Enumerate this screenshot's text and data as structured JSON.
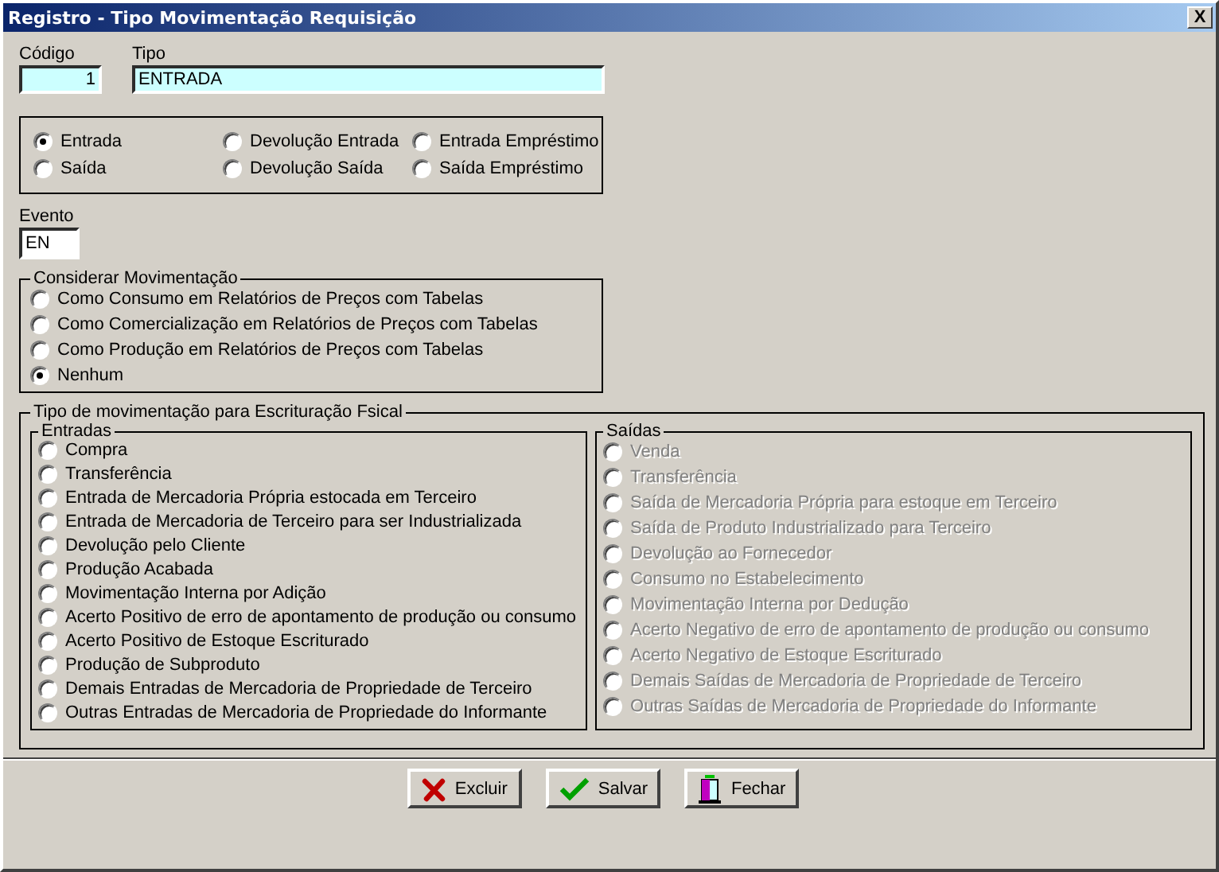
{
  "window": {
    "title": "Registro - Tipo Movimentação Requisição",
    "close": "X"
  },
  "codigo": {
    "label": "Código",
    "value": "1"
  },
  "tipo": {
    "label": "Tipo",
    "value": "ENTRADA"
  },
  "tipo_options": [
    {
      "label": "Entrada",
      "selected": true
    },
    {
      "label": "Devolução Entrada",
      "selected": false
    },
    {
      "label": "Entrada Empréstimo",
      "selected": false
    },
    {
      "label": "Saída",
      "selected": false
    },
    {
      "label": "Devolução Saída",
      "selected": false
    },
    {
      "label": "Saída Empréstimo",
      "selected": false
    }
  ],
  "evento": {
    "label": "Evento",
    "value": "EN"
  },
  "considerar": {
    "title": "Considerar Movimentação",
    "options": [
      {
        "label": "Como Consumo em Relatórios de Preços com Tabelas",
        "selected": false
      },
      {
        "label": "Como Comercialização em Relatórios de Preços com Tabelas",
        "selected": false
      },
      {
        "label": "Como Produção em Relatórios de Preços com Tabelas",
        "selected": false
      },
      {
        "label": "Nenhum",
        "selected": true
      }
    ]
  },
  "fiscal": {
    "title": "Tipo de movimentação para Escrituração Fsical",
    "groups": [
      {
        "title": "Entradas",
        "disabled": false,
        "options": [
          {
            "label": "Compra",
            "selected": false
          },
          {
            "label": "Transferência",
            "selected": false
          },
          {
            "label": "Entrada de Mercadoria Própria estocada em Terceiro",
            "selected": false
          },
          {
            "label": "Entrada de Mercadoria de Terceiro para ser Industrializada",
            "selected": false
          },
          {
            "label": "Devolução pelo Cliente",
            "selected": false
          },
          {
            "label": "Produção Acabada",
            "selected": false
          },
          {
            "label": "Movimentação Interna por Adição",
            "selected": false
          },
          {
            "label": "Acerto Positivo de erro de apontamento de produção ou consumo",
            "selected": false
          },
          {
            "label": "Acerto Positivo de Estoque Escriturado",
            "selected": false
          },
          {
            "label": "Produção de Subproduto",
            "selected": false
          },
          {
            "label": "Demais Entradas de Mercadoria de Propriedade de Terceiro",
            "selected": false
          },
          {
            "label": "Outras Entradas de Mercadoria de Propriedade do Informante",
            "selected": false
          }
        ]
      },
      {
        "title": "Saídas",
        "disabled": true,
        "options": [
          {
            "label": "Venda",
            "selected": false
          },
          {
            "label": "Transferência",
            "selected": false
          },
          {
            "label": "Saída de Mercadoria Própria para estoque em Terceiro",
            "selected": false
          },
          {
            "label": "Saída de Produto Industrializado para Terceiro",
            "selected": false
          },
          {
            "label": "Devolução ao Fornecedor",
            "selected": false
          },
          {
            "label": "Consumo no Estabelecimento",
            "selected": false
          },
          {
            "label": "Movimentação Interna por Dedução",
            "selected": false
          },
          {
            "label": "Acerto Negativo de erro de apontamento de produção ou consumo",
            "selected": false
          },
          {
            "label": "Acerto Negativo de Estoque Escriturado",
            "selected": false
          },
          {
            "label": "Demais Saídas de Mercadoria de Propriedade de Terceiro",
            "selected": false
          },
          {
            "label": "Outras Saídas de Mercadoria de Propriedade do Informante",
            "selected": false
          }
        ]
      }
    ]
  },
  "buttons": [
    {
      "label": "Excluir",
      "kind": "delete"
    },
    {
      "label": "Salvar",
      "kind": "save"
    },
    {
      "label": "Fechar",
      "kind": "close"
    }
  ]
}
